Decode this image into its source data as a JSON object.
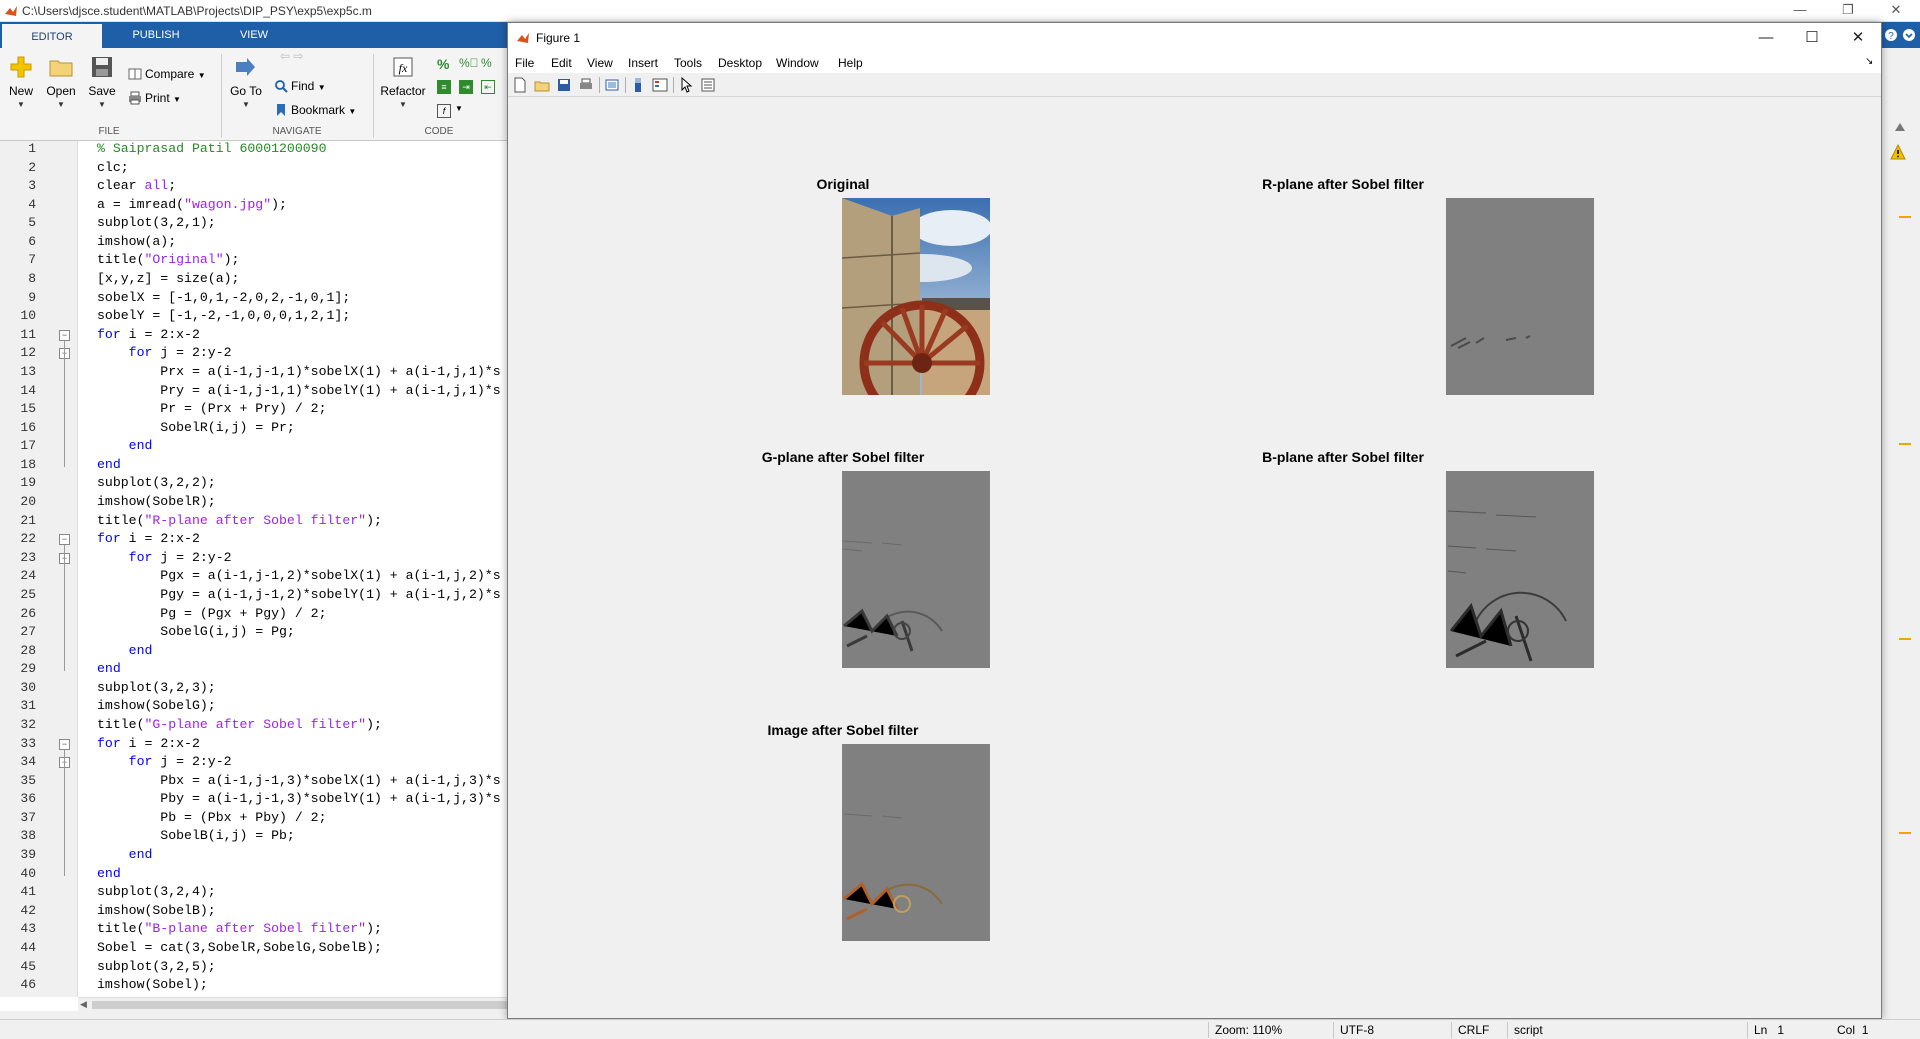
{
  "window": {
    "path": "C:\\Users\\djsce.student\\MATLAB\\Projects\\DIP_PSY\\exp5\\exp5c.m",
    "controls": {
      "minimize": "—",
      "restore": "❐",
      "close": "✕"
    }
  },
  "ribbon": {
    "tabs": [
      "EDITOR",
      "PUBLISH",
      "VIEW"
    ],
    "file": {
      "new": "New",
      "open": "Open",
      "save": "Save",
      "compare": "Compare",
      "print": "Print",
      "group": "FILE"
    },
    "navigate": {
      "goto": "Go To",
      "find": "Find",
      "bookmark": "Bookmark",
      "group": "NAVIGATE"
    },
    "code": {
      "refactor": "Refactor",
      "group": "CODE"
    }
  },
  "editor": {
    "lines": [
      [
        {
          "t": "% Saiprasad Patil 60001200090",
          "c": "com"
        }
      ],
      [
        {
          "t": "clc;"
        }
      ],
      [
        {
          "t": "clear "
        },
        {
          "t": "all",
          "c": "str"
        },
        {
          "t": ";"
        }
      ],
      [
        {
          "t": "a = imread("
        },
        {
          "t": "\"wagon.jpg\"",
          "c": "str"
        },
        {
          "t": ");"
        }
      ],
      [
        {
          "t": "subplot(3,2,1);"
        }
      ],
      [
        {
          "t": "imshow(a);"
        }
      ],
      [
        {
          "t": "title("
        },
        {
          "t": "\"Original\"",
          "c": "str"
        },
        {
          "t": ");"
        }
      ],
      [
        {
          "t": "[x,y,z] = size(a);"
        }
      ],
      [
        {
          "t": "sobelX = [-1,0,1,-2,0,2,-1,0,1];"
        }
      ],
      [
        {
          "t": "sobelY = [-1,-2,-1,0,0,0,1,2,1];"
        }
      ],
      [
        {
          "t": "for",
          "c": "kw"
        },
        {
          "t": " i = 2:x-2"
        }
      ],
      [
        {
          "t": "    "
        },
        {
          "t": "for",
          "c": "kw"
        },
        {
          "t": " j = 2:y-2"
        }
      ],
      [
        {
          "t": "        Prx = a(i-1,j-1,1)*sobelX(1) + a(i-1,j,1)*s"
        }
      ],
      [
        {
          "t": "        Pry = a(i-1,j-1,1)*sobelY(1) + a(i-1,j,1)*s"
        }
      ],
      [
        {
          "t": "        Pr = (Prx + Pry) / 2;"
        }
      ],
      [
        {
          "t": "        SobelR(i,j) = Pr;"
        }
      ],
      [
        {
          "t": "    "
        },
        {
          "t": "end",
          "c": "kw"
        }
      ],
      [
        {
          "t": "end",
          "c": "kw"
        }
      ],
      [
        {
          "t": "subplot(3,2,2);"
        }
      ],
      [
        {
          "t": "imshow(SobelR);"
        }
      ],
      [
        {
          "t": "title("
        },
        {
          "t": "\"R-plane after Sobel filter\"",
          "c": "str"
        },
        {
          "t": ");"
        }
      ],
      [
        {
          "t": "for",
          "c": "kw"
        },
        {
          "t": " i = 2:x-2"
        }
      ],
      [
        {
          "t": "    "
        },
        {
          "t": "for",
          "c": "kw"
        },
        {
          "t": " j = 2:y-2"
        }
      ],
      [
        {
          "t": "        Pgx = a(i-1,j-1,2)*sobelX(1) + a(i-1,j,2)*s"
        }
      ],
      [
        {
          "t": "        Pgy = a(i-1,j-1,2)*sobelY(1) + a(i-1,j,2)*s"
        }
      ],
      [
        {
          "t": "        Pg = (Pgx + Pgy) / 2;"
        }
      ],
      [
        {
          "t": "        SobelG(i,j) = Pg;"
        }
      ],
      [
        {
          "t": "    "
        },
        {
          "t": "end",
          "c": "kw"
        }
      ],
      [
        {
          "t": "end",
          "c": "kw"
        }
      ],
      [
        {
          "t": "subplot(3,2,3);"
        }
      ],
      [
        {
          "t": "imshow(SobelG);"
        }
      ],
      [
        {
          "t": "title("
        },
        {
          "t": "\"G-plane after Sobel filter\"",
          "c": "str"
        },
        {
          "t": ");"
        }
      ],
      [
        {
          "t": "for",
          "c": "kw"
        },
        {
          "t": " i = 2:x-2"
        }
      ],
      [
        {
          "t": "    "
        },
        {
          "t": "for",
          "c": "kw"
        },
        {
          "t": " j = 2:y-2"
        }
      ],
      [
        {
          "t": "        Pbx = a(i-1,j-1,3)*sobelX(1) + a(i-1,j,3)*s"
        }
      ],
      [
        {
          "t": "        Pby = a(i-1,j-1,3)*sobelY(1) + a(i-1,j,3)*s"
        }
      ],
      [
        {
          "t": "        Pb = (Pbx + Pby) / 2;"
        }
      ],
      [
        {
          "t": "        SobelB(i,j) = Pb;"
        }
      ],
      [
        {
          "t": "    "
        },
        {
          "t": "end",
          "c": "kw"
        }
      ],
      [
        {
          "t": "end",
          "c": "kw"
        }
      ],
      [
        {
          "t": "subplot(3,2,4);"
        }
      ],
      [
        {
          "t": "imshow(SobelB);"
        }
      ],
      [
        {
          "t": "title("
        },
        {
          "t": "\"B-plane after Sobel filter\"",
          "c": "str"
        },
        {
          "t": ");"
        }
      ],
      [
        {
          "t": "Sobel = cat(3,SobelR,SobelG,SobelB);"
        }
      ],
      [
        {
          "t": "subplot(3,2,5);"
        }
      ],
      [
        {
          "t": "imshow(Sobel);"
        }
      ]
    ],
    "fold_lines": [
      11,
      12,
      22,
      23,
      33,
      34
    ]
  },
  "figure": {
    "title": "Figure 1",
    "menu": [
      "File",
      "Edit",
      "View",
      "Insert",
      "Tools",
      "Desktop",
      "Window",
      "Help"
    ],
    "subplots": [
      {
        "title": "Original",
        "kind": "photo"
      },
      {
        "title": "R-plane after Sobel filter",
        "kind": "edge-r"
      },
      {
        "title": "G-plane after Sobel filter",
        "kind": "edge-g"
      },
      {
        "title": "B-plane after Sobel filter",
        "kind": "edge-b"
      },
      {
        "title": "Image after Sobel filter",
        "kind": "edge-rgb"
      }
    ]
  },
  "status": {
    "zoom": "Zoom: 110%",
    "encoding": "UTF-8",
    "line_ending": "CRLF",
    "type": "script",
    "ln_label": "Ln",
    "ln": "1",
    "col_label": "Col",
    "col": "1"
  },
  "colors": {
    "ribbon_blue": "#1f5fa8",
    "warning": "#f0a400"
  }
}
